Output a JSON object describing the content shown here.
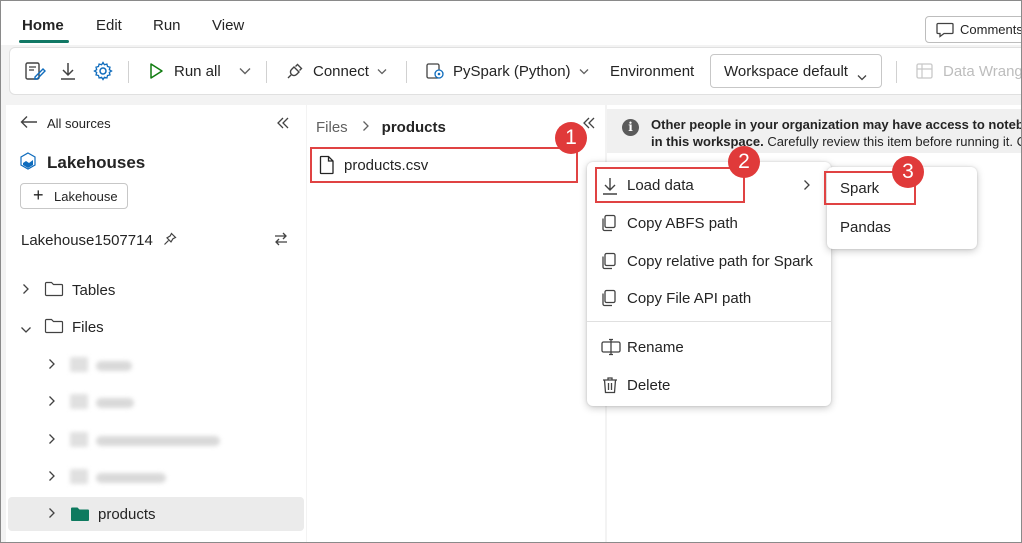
{
  "menu": {
    "tabs": [
      {
        "label": "Home"
      },
      {
        "label": "Edit"
      },
      {
        "label": "Run"
      },
      {
        "label": "View"
      }
    ],
    "comments_label": "Comments"
  },
  "toolbar": {
    "run_all_label": "Run all",
    "connect_label": "Connect",
    "language_label": "PySpark (Python)",
    "environment_label": "Environment",
    "workspace_select_value": "Workspace default",
    "data_wrangler_label": "Data Wrang"
  },
  "explorer": {
    "back_label": "All sources",
    "section_title": "Lakehouses",
    "add_lakehouse_label": "Lakehouse",
    "lakehouse_name": "Lakehouse1507714",
    "tree": [
      {
        "label": "Tables"
      },
      {
        "label": "Files"
      },
      {
        "label": "products"
      }
    ]
  },
  "files_pane": {
    "breadcrumb_root": "Files",
    "breadcrumb_current": "products",
    "file_name": "products.csv"
  },
  "info_banner": {
    "line1": "Other people in your organization may have access to noteb",
    "line2_bold": "in this workspace.",
    "line2_rest": " Carefully review this item before running it. C"
  },
  "context_menu": {
    "items": [
      {
        "label": "Load data",
        "icon": "download-icon"
      },
      {
        "label": "Copy ABFS path",
        "icon": "copy-icon"
      },
      {
        "label": "Copy relative path for Spark",
        "icon": "copy-icon"
      },
      {
        "label": "Copy File API path",
        "icon": "copy-icon"
      },
      {
        "label": "Rename",
        "icon": "rename-icon"
      },
      {
        "label": "Delete",
        "icon": "trash-icon"
      }
    ]
  },
  "submenu": {
    "items": [
      {
        "label": "Spark"
      },
      {
        "label": "Pandas"
      }
    ]
  },
  "badges": [
    "1",
    "2",
    "3"
  ],
  "colors": {
    "accent": "#117865",
    "highlight_red": "#e04343",
    "folder_green": "#0e7a5f"
  }
}
